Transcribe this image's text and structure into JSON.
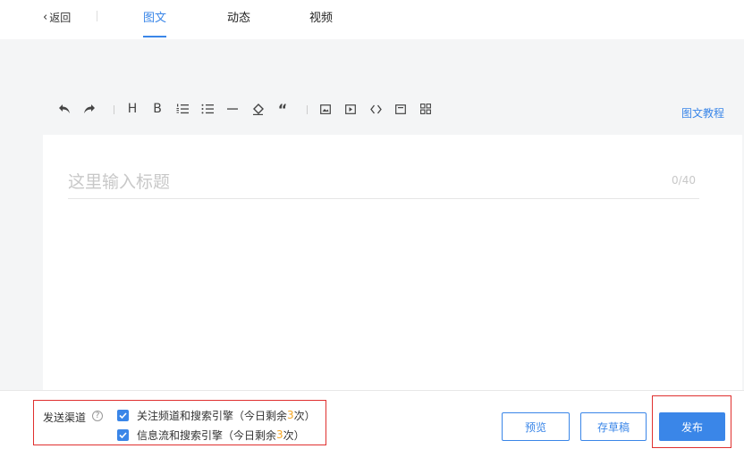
{
  "nav": {
    "back_label": "返回",
    "tabs": [
      {
        "label": "图文",
        "active": true
      },
      {
        "label": "动态",
        "active": false
      },
      {
        "label": "视频",
        "active": false
      }
    ]
  },
  "toolbar": {
    "icons": [
      "undo-icon",
      "redo-icon",
      "heading-icon",
      "bold-icon",
      "ordered-list-icon",
      "unordered-list-icon",
      "divider-icon",
      "clear-format-icon",
      "quote-icon",
      "image-icon",
      "video-icon",
      "code-icon",
      "card-icon",
      "grid-icon"
    ],
    "heading_glyph": "H",
    "bold_glyph": "B",
    "quote_glyph": "“",
    "tutorial_label": "图文教程"
  },
  "editor": {
    "title_placeholder": "这里输入标题",
    "title_value": "",
    "counter": "0/40"
  },
  "bottom": {
    "channel_label": "发送渠道",
    "help_glyph": "?",
    "options": [
      {
        "prefix": "关注频道和搜索引擎（今日剩余",
        "count": "3",
        "suffix": "次）",
        "checked": true
      },
      {
        "prefix": "信息流和搜索引擎（今日剩余",
        "count": "3",
        "suffix": "次）",
        "checked": true
      }
    ],
    "buttons": {
      "preview": "预览",
      "draft": "存草稿",
      "publish": "发布"
    }
  },
  "colors": {
    "accent": "#3a86e8",
    "highlight": "#e0302f",
    "remaining": "#f5a623"
  }
}
